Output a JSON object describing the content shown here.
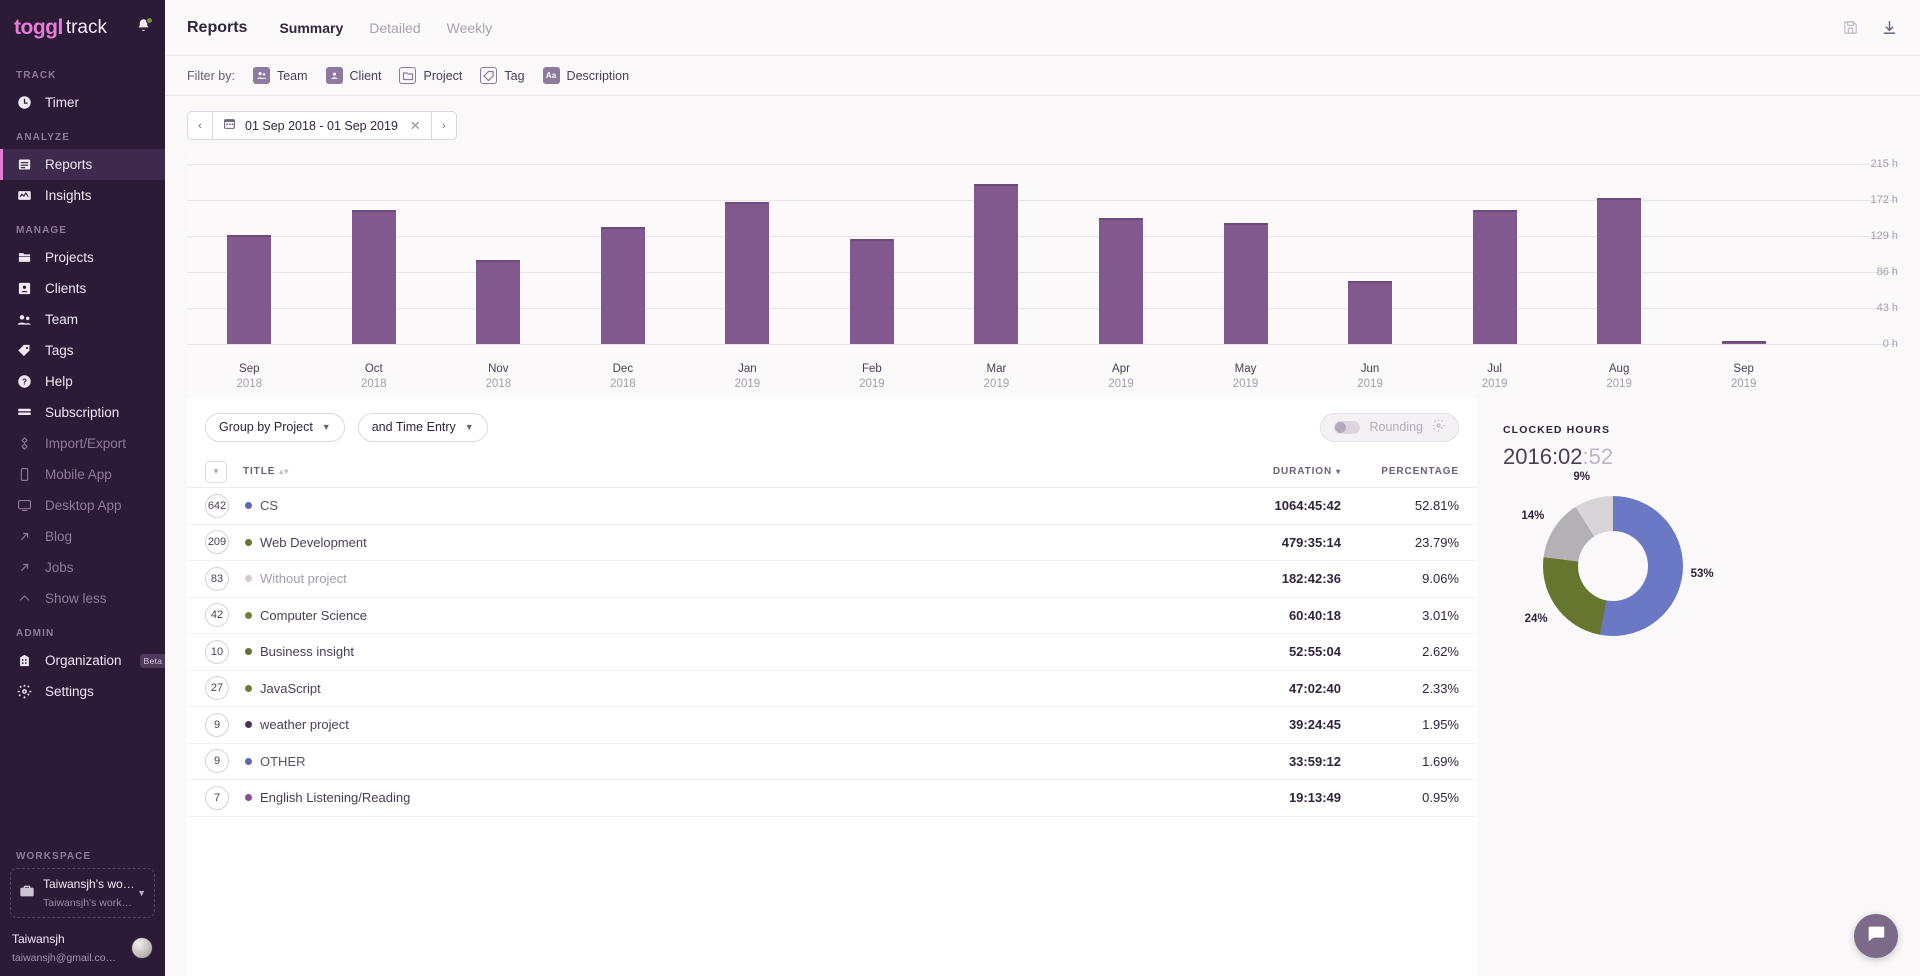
{
  "brand": {
    "name_bold": "toggl",
    "name_light": "track",
    "bell_icon": "bell-icon"
  },
  "sidebar": {
    "sections": [
      {
        "label": "TRACK",
        "items": [
          {
            "label": "Timer",
            "icon": "clock-icon",
            "state": "normal"
          }
        ]
      },
      {
        "label": "ANALYZE",
        "items": [
          {
            "label": "Reports",
            "icon": "reports-icon",
            "state": "active"
          },
          {
            "label": "Insights",
            "icon": "insights-icon",
            "state": "normal"
          }
        ]
      },
      {
        "label": "MANAGE",
        "items": [
          {
            "label": "Projects",
            "icon": "folder-icon",
            "state": "normal"
          },
          {
            "label": "Clients",
            "icon": "person-card-icon",
            "state": "normal"
          },
          {
            "label": "Team",
            "icon": "people-icon",
            "state": "normal"
          },
          {
            "label": "Tags",
            "icon": "tag-icon",
            "state": "normal"
          },
          {
            "label": "Help",
            "icon": "question-circle-icon",
            "state": "normal"
          },
          {
            "label": "Subscription",
            "icon": "card-icon",
            "state": "normal"
          },
          {
            "label": "Import/Export",
            "icon": "import-export-icon",
            "state": "dim"
          },
          {
            "label": "Mobile App",
            "icon": "phone-icon",
            "state": "dim"
          },
          {
            "label": "Desktop App",
            "icon": "monitor-icon",
            "state": "dim"
          },
          {
            "label": "Blog",
            "icon": "external-arrow-icon",
            "state": "dim"
          },
          {
            "label": "Jobs",
            "icon": "external-arrow-icon",
            "state": "dim"
          },
          {
            "label": "Show less",
            "icon": "chevron-up-icon",
            "state": "dim"
          }
        ]
      },
      {
        "label": "ADMIN",
        "items": [
          {
            "label": "Organization",
            "icon": "building-icon",
            "state": "normal",
            "badge": "Beta"
          },
          {
            "label": "Settings",
            "icon": "gear-icon",
            "state": "normal"
          }
        ]
      }
    ],
    "workspace_section_label": "WORKSPACE",
    "workspace": {
      "icon": "briefcase-icon",
      "name": "Taiwansjh's wo…",
      "sub": "Taiwansjh's work…",
      "caret_icon": "chevron-down-icon"
    },
    "user": {
      "name": "Taiwansjh",
      "email": "taiwansjh@gmail.co…",
      "avatar_icon": "avatar"
    }
  },
  "header": {
    "title": "Reports",
    "tabs": [
      {
        "label": "Summary",
        "active": true
      },
      {
        "label": "Detailed",
        "active": false
      },
      {
        "label": "Weekly",
        "active": false
      }
    ],
    "icons": [
      {
        "name": "save-icon",
        "label": "Save report"
      },
      {
        "name": "download-icon",
        "label": "Download report"
      }
    ]
  },
  "filter_bar": {
    "label": "Filter by:",
    "chips": [
      {
        "label": "Team",
        "icon": "people-icon"
      },
      {
        "label": "Client",
        "icon": "person-card-icon"
      },
      {
        "label": "Project",
        "icon": "folder-icon"
      },
      {
        "label": "Tag",
        "icon": "tag-icon"
      },
      {
        "label": "Description",
        "icon": "aa-text-icon"
      }
    ]
  },
  "date_range": {
    "prev_icon": "chevron-left-icon",
    "next_icon": "chevron-right-icon",
    "calendar_icon": "calendar-icon",
    "value": "01 Sep 2018 - 01 Sep 2019",
    "clear_icon": "close-icon"
  },
  "chart_data": {
    "type": "bar",
    "title": "",
    "xlabel": "",
    "ylabel": "",
    "ylim": [
      0,
      215
    ],
    "grid": true,
    "bar_color": "#82598f",
    "ytick_labels": [
      "215 h",
      "172 h",
      "129 h",
      "86 h",
      "43 h",
      "0 h"
    ],
    "ytick_values": [
      215,
      172,
      129,
      86,
      43,
      0
    ],
    "categories": [
      "Sep",
      "Oct",
      "Nov",
      "Dec",
      "Jan",
      "Feb",
      "Mar",
      "Apr",
      "May",
      "Jun",
      "Jul",
      "Aug",
      "Sep"
    ],
    "category_years": [
      "2018",
      "2018",
      "2018",
      "2018",
      "2019",
      "2019",
      "2019",
      "2019",
      "2019",
      "2019",
      "2019",
      "2019",
      "2019"
    ],
    "values": [
      130,
      160,
      100,
      140,
      170,
      125,
      191,
      150,
      145,
      75,
      160,
      175,
      3
    ]
  },
  "controls": {
    "group_by": {
      "label": "Group by Project",
      "caret_icon": "chevron-down-icon"
    },
    "subgroup_by": {
      "label": "and Time Entry",
      "caret_icon": "chevron-down-icon"
    },
    "rounding": {
      "label": "Rounding",
      "enabled": false,
      "gear_icon": "gear-icon",
      "toggle_icon": "toggle-off-icon"
    }
  },
  "table": {
    "select_all_icon": "chevron-down-icon",
    "columns": [
      {
        "key": "title",
        "label": "TITLE",
        "sorted": false
      },
      {
        "key": "duration",
        "label": "DURATION",
        "sorted": true
      },
      {
        "key": "percentage",
        "label": "PERCENTAGE",
        "sorted": false
      }
    ],
    "rows": [
      {
        "count": "642",
        "title": "CS",
        "color": "#5d68b5",
        "duration": "1064:45:42",
        "percentage": "52.81%",
        "title_color": "#5d4f68"
      },
      {
        "count": "209",
        "title": "Web Development",
        "color": "#66762f",
        "duration": "479:35:14",
        "percentage": "23.79%",
        "title_color": "#4b3d57"
      },
      {
        "count": "83",
        "title": "Without project",
        "color": "#d3cbd6",
        "duration": "182:42:36",
        "percentage": "9.06%",
        "title_color": "#a79cae"
      },
      {
        "count": "42",
        "title": "Computer Science",
        "color": "#6f7f36",
        "duration": "60:40:18",
        "percentage": "3.01%",
        "title_color": "#4b3d57"
      },
      {
        "count": "10",
        "title": "Business insight",
        "color": "#5f7030",
        "duration": "52:55:04",
        "percentage": "2.62%",
        "title_color": "#4b3d57"
      },
      {
        "count": "27",
        "title": "JavaScript",
        "color": "#6d7b3a",
        "duration": "47:02:40",
        "percentage": "2.33%",
        "title_color": "#4b3d57"
      },
      {
        "count": "9",
        "title": "weather project",
        "color": "#4a3257",
        "duration": "39:24:45",
        "percentage": "1.95%",
        "title_color": "#4b3d57"
      },
      {
        "count": "9",
        "title": "OTHER",
        "color": "#5d68b5",
        "duration": "33:59:12",
        "percentage": "1.69%",
        "title_color": "#5d4f68"
      },
      {
        "count": "7",
        "title": "English Listening/Reading",
        "color": "#8d4f91",
        "duration": "19:13:49",
        "percentage": "0.95%",
        "title_color": "#4b3d57"
      }
    ]
  },
  "summary_panel": {
    "label": "CLOCKED HOURS",
    "total_main": "2016:02",
    "total_frac": ":52",
    "donut": {
      "type": "pie",
      "slices": [
        {
          "label": "53%",
          "value": 53,
          "color": "#6b78c4"
        },
        {
          "label": "24%",
          "value": 24,
          "color": "#66762f"
        },
        {
          "label": "14%",
          "value": 14,
          "color": "#b5b0b5"
        },
        {
          "label": "9%",
          "value": 9,
          "color": "#d8d4d8"
        }
      ]
    }
  },
  "chat": {
    "icon": "chat-icon",
    "color": "#7b6a88"
  }
}
